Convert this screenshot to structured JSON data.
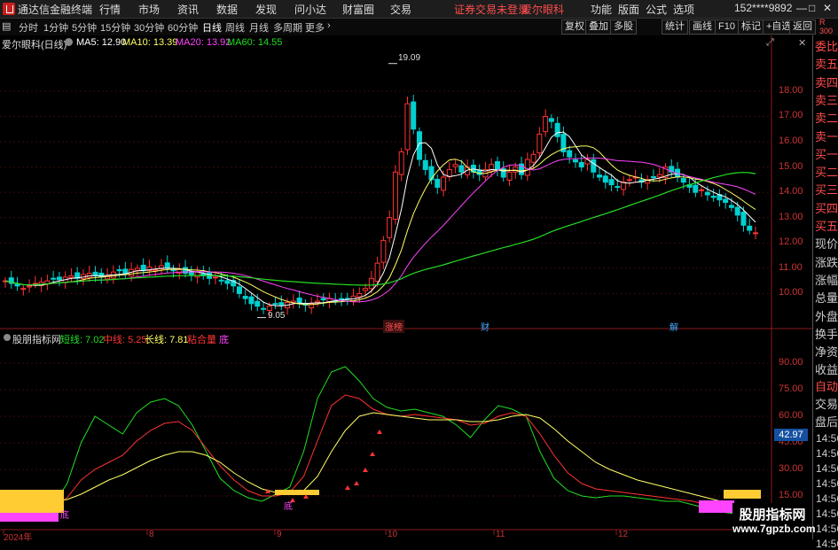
{
  "titlebar": {
    "app_name": "通达信金融终端",
    "menus": [
      "行情",
      "市场",
      "资讯",
      "数据",
      "发现",
      "问小达",
      "财富圈",
      "交易"
    ],
    "notice": "证券交易未登录",
    "stock_name": "爱尔眼科",
    "right_menus": [
      "功能",
      "版面",
      "公式",
      "选项"
    ],
    "account": "152****9892"
  },
  "toolbar": {
    "periods": [
      "分时",
      "1分钟",
      "5分钟",
      "15分钟",
      "30分钟",
      "60分钟",
      "日线",
      "周线",
      "月线",
      "多周期",
      "更多"
    ],
    "buttons": [
      "复权",
      "叠加",
      "多股",
      "统计",
      "画线",
      "F10",
      "标记",
      "+自选",
      "返回"
    ]
  },
  "main_legend": {
    "stock": "爱尔眼科(日线)",
    "ma5": "MA5: 12.90",
    "ma10": "MA10: 13.39",
    "ma20": "MA20: 13.92",
    "ma60": "MA60: 14.55"
  },
  "sub_legend": {
    "name": "股朋指标网",
    "short": "短线: 7.02",
    "mid": "中线: 5.25",
    "long": "长线: 7.81",
    "signal1": "粘合量",
    "signal2": "底"
  },
  "annotations": {
    "high": "19.09",
    "low": "9.05",
    "zt": "涨榜",
    "cai": "财",
    "jie": "解",
    "sub_low1": "底",
    "sub_cross": "底"
  },
  "sidebar": {
    "items": [
      "委比",
      "卖五",
      "卖四",
      "卖三",
      "卖二",
      "卖一",
      "买一",
      "买二",
      "买三",
      "买四",
      "买五",
      "现价",
      "涨跌",
      "涨幅",
      "总量",
      "外盘",
      "换手",
      "净资",
      "收益",
      "自动",
      "交易",
      "盘后"
    ],
    "times": [
      "14:56",
      "14:56",
      "14:56",
      "14:56",
      "14:56",
      "14:56",
      "14:56",
      "14:56"
    ],
    "corner": "R 300"
  },
  "axis": {
    "main_ticks": [
      "18.00",
      "17.00",
      "16.00",
      "15.00",
      "14.00",
      "13.00",
      "12.00",
      "11.00",
      "10.00"
    ],
    "sub_ticks": [
      "90.00",
      "75.00",
      "60.00",
      "45.00",
      "30.00",
      "15.00"
    ],
    "sub_current": "42.97",
    "dates": [
      "2024年",
      "8",
      "9",
      "10",
      "11",
      "12"
    ]
  },
  "watermark": {
    "line1": "股朋指标网",
    "line2": "www.7gpzb.com"
  },
  "colors": {
    "up": "#ff3333",
    "down": "#00d0d0",
    "ma5": "#ffffff",
    "ma10": "#ffff66",
    "ma20": "#ff44ff",
    "ma60": "#22dd22"
  },
  "chart_data": [
    {
      "type": "candlestick",
      "title": "爱尔眼科(日线)",
      "ylim": [
        9.0,
        19.5
      ],
      "close": [
        10.5,
        10.4,
        10.3,
        10.2,
        10.3,
        10.4,
        10.45,
        10.5,
        10.6,
        10.55,
        10.65,
        10.7,
        10.6,
        10.75,
        10.8,
        10.7,
        10.65,
        10.7,
        10.85,
        10.9,
        10.8,
        10.95,
        11.0,
        10.9,
        11.05,
        10.95,
        11.1,
        11.0,
        10.9,
        10.95,
        10.8,
        10.75,
        10.85,
        10.7,
        10.6,
        10.65,
        10.5,
        10.4,
        10.3,
        10.0,
        9.8,
        9.6,
        9.5,
        9.4,
        9.5,
        9.6,
        9.55,
        9.65,
        9.7,
        9.6,
        9.55,
        9.6,
        9.7,
        9.75,
        9.8,
        9.7,
        9.75,
        9.8,
        9.9,
        10.0,
        10.2,
        10.6,
        11.2,
        12.1,
        13.0,
        14.8,
        15.6,
        17.5,
        16.5,
        15.3,
        14.9,
        14.5,
        14.2,
        14.6,
        14.9,
        15.1,
        14.8,
        15.0,
        14.8,
        14.7,
        14.9,
        15.1,
        14.9,
        14.6,
        14.8,
        15.0,
        14.7,
        15.3,
        15.5,
        16.3,
        17.0,
        16.8,
        16.2,
        15.6,
        15.4,
        15.2,
        15.0,
        15.3,
        14.8,
        14.6,
        14.4,
        14.3,
        14.2,
        14.4,
        14.5,
        14.6,
        14.4,
        14.5,
        14.6,
        14.7,
        15.0,
        14.8,
        14.6,
        14.4,
        14.2,
        14.0,
        14.1,
        13.9,
        13.8,
        13.7,
        13.6,
        13.4,
        13.1,
        12.7,
        12.5,
        12.4
      ],
      "ma": {
        "ma5": "12.90",
        "ma10": "13.39",
        "ma20": "13.92",
        "ma60": "14.55"
      }
    },
    {
      "type": "line",
      "title": "股朋指标网",
      "ylim": [
        0,
        100
      ],
      "series": [
        {
          "name": "短线",
          "values": [
            10,
            22,
            45,
            60,
            55,
            50,
            62,
            68,
            70,
            66,
            55,
            40,
            25,
            18,
            14,
            12,
            16,
            20,
            40,
            70,
            85,
            88,
            80,
            70,
            65,
            63,
            64,
            62,
            60,
            55,
            48,
            58,
            66,
            64,
            60,
            40,
            25,
            18,
            15,
            14,
            15,
            15,
            14,
            13,
            12,
            12,
            10,
            8,
            6,
            5,
            4,
            7
          ]
        },
        {
          "name": "中线",
          "values": [
            8,
            14,
            24,
            30,
            34,
            38,
            46,
            52,
            56,
            57,
            52,
            42,
            32,
            24,
            18,
            15,
            15,
            17,
            26,
            46,
            66,
            72,
            70,
            64,
            61,
            60,
            61,
            60,
            59,
            58,
            55,
            56,
            60,
            62,
            60,
            50,
            38,
            28,
            22,
            19,
            18,
            17,
            16,
            15,
            14,
            13,
            12,
            10,
            8,
            6,
            5,
            5
          ]
        },
        {
          "name": "长线",
          "values": [
            12,
            13,
            16,
            20,
            24,
            27,
            31,
            35,
            38,
            40,
            40,
            38,
            34,
            28,
            23,
            19,
            17,
            16,
            18,
            26,
            40,
            52,
            60,
            62,
            61,
            60,
            59,
            58,
            58,
            58,
            57,
            57,
            58,
            60,
            61,
            59,
            53,
            46,
            40,
            34,
            30,
            27,
            24,
            22,
            20,
            18,
            16,
            14,
            12,
            10,
            9,
            8
          ]
        }
      ]
    }
  ]
}
